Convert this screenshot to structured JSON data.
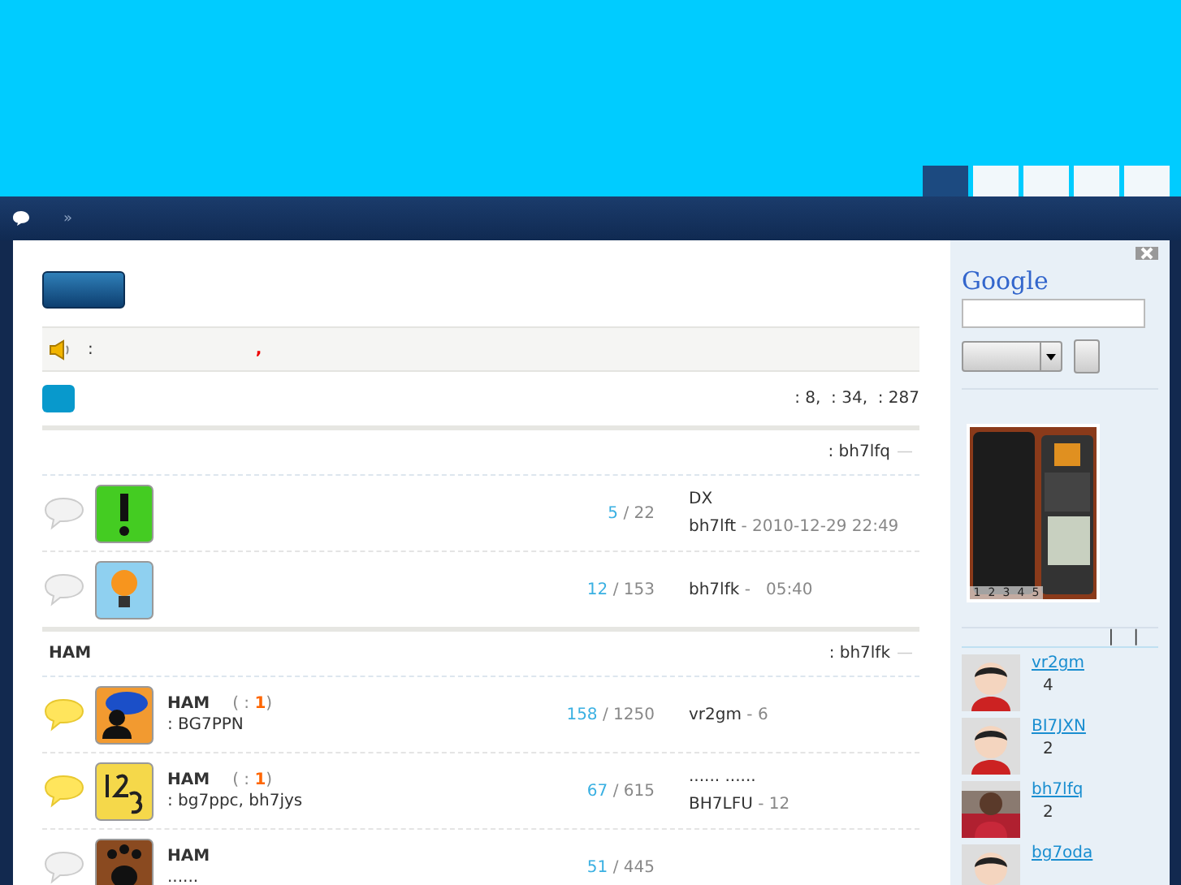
{
  "nav_tabs": [
    {
      "selected": true
    },
    {
      "selected": false
    },
    {
      "selected": false
    },
    {
      "selected": false
    },
    {
      "selected": false
    }
  ],
  "breadcrumb": {
    "separator": "»"
  },
  "notice": {
    "separator": ":",
    "mark": ","
  },
  "stats": ": 8,  : 34,  : 287",
  "count_separator": "/",
  "sections": [
    {
      "moderator": ": bh7lfq",
      "trail": "—",
      "forums": [
        {
          "new": false,
          "kind": "alert",
          "topics": "5",
          "posts": "22",
          "last_title": "DX",
          "last_author": "bh7lft",
          "last_time": " - 2010-12-29 22:49"
        },
        {
          "new": false,
          "kind": "bulb",
          "topics": "12",
          "posts": "153",
          "last_author": "bh7lfk",
          "last_time": " -   05:40"
        }
      ]
    },
    {
      "title": "HAM",
      "moderator": ": bh7lfk",
      "trail": "—",
      "forums": [
        {
          "new": true,
          "kind": "chat",
          "name": "HAM",
          "today": {
            "open": "( :",
            "value": "1",
            "close": ")"
          },
          "description": ": BG7PPN",
          "topics": "158",
          "posts": "1250",
          "last_author": "vr2gm",
          "last_time": " - 6"
        },
        {
          "new": true,
          "kind": "numbers",
          "name": "HAM",
          "today": {
            "open": "( :",
            "value": "1",
            "close": ")"
          },
          "description": ": bg7ppc, bh7jys",
          "topics": "67",
          "posts": "615",
          "last_title": "......  ......",
          "last_author": "BH7LFU",
          "last_time": " - 12"
        },
        {
          "new": false,
          "kind": "paw",
          "name": "HAM",
          "description": "......",
          "topics": "51",
          "posts": "445"
        }
      ]
    }
  ],
  "sidebar": {
    "logo": "Google",
    "slide_tabs": [
      "1",
      "2",
      "3",
      "4",
      "5"
    ],
    "links": [
      "|",
      "|"
    ],
    "members": [
      {
        "name": "vr2gm",
        "count": "4",
        "kind": "cartoon"
      },
      {
        "name": "BI7JXN",
        "count": "2",
        "kind": "cartoon"
      },
      {
        "name": "bh7lfq",
        "count": "2"
      },
      {
        "name": "bg7oda",
        "kind": "cartoon"
      }
    ]
  }
}
